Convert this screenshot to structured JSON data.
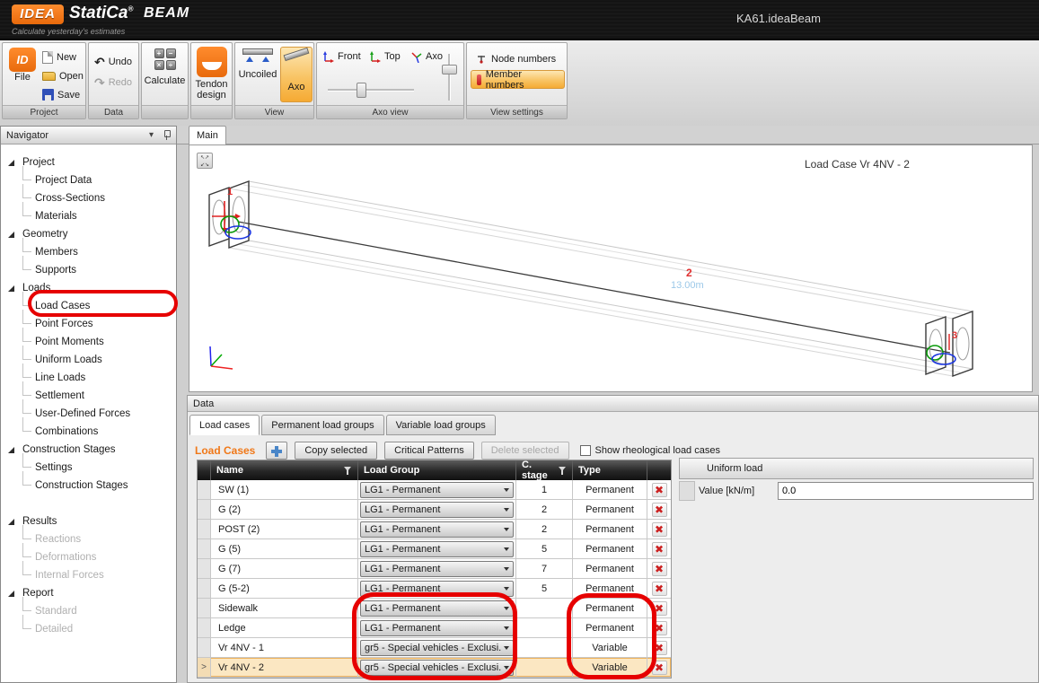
{
  "colors": {
    "accent_orange": "#f07818",
    "brand_orange": "#e86a0c",
    "selected_row_bg": "#fbe7c2",
    "annotation_red": "#e60000",
    "table_header_bg": "#262626",
    "delete_red": "#cc2020",
    "plus_blue": "#4a86c8"
  },
  "title_bar": {
    "logo_idea": "IDEA",
    "logo_statica": "StatiCa",
    "logo_reg": "®",
    "logo_beam": "BEAM",
    "tagline": "Calculate yesterday's estimates",
    "document_title": "KA61.ideaBeam"
  },
  "ribbon": {
    "project": {
      "group_label": "Project",
      "file": "File",
      "file_icon_text": "ID",
      "new": "New",
      "open": "Open",
      "save": "Save"
    },
    "data_group": {
      "group_label": "Data",
      "undo": "Undo",
      "redo": "Redo",
      "undo_icon": "↶",
      "redo_icon": "↷"
    },
    "calculate": {
      "label": "Calculate",
      "glyph_plus": "+",
      "glyph_minus": "−",
      "glyph_mult": "×",
      "glyph_div": "÷"
    },
    "tendon": {
      "label": "Tendon design"
    },
    "view": {
      "group_label": "View",
      "uncoiled": "Uncoiled",
      "axo": "Axo"
    },
    "axo_view": {
      "group_label": "Axo view",
      "front": "Front",
      "top": "Top",
      "axo": "Axo"
    },
    "view_settings": {
      "group_label": "View settings",
      "node_numbers": "Node numbers",
      "member_numbers": "Member numbers"
    }
  },
  "navigator": {
    "title": "Navigator",
    "collapse_icon": "▾",
    "tree": [
      {
        "label": "Project",
        "level": 0
      },
      {
        "label": "Project Data",
        "level": 1
      },
      {
        "label": "Cross-Sections",
        "level": 1
      },
      {
        "label": "Materials",
        "level": 1
      },
      {
        "label": "Geometry",
        "level": 0
      },
      {
        "label": "Members",
        "level": 1
      },
      {
        "label": "Supports",
        "level": 1
      },
      {
        "label": "Loads",
        "level": 0
      },
      {
        "label": "Load Cases",
        "level": 1,
        "circled": true
      },
      {
        "label": "Point Forces",
        "level": 1
      },
      {
        "label": "Point Moments",
        "level": 1
      },
      {
        "label": "Uniform Loads",
        "level": 1
      },
      {
        "label": "Line Loads",
        "level": 1
      },
      {
        "label": "Settlement",
        "level": 1
      },
      {
        "label": "User-Defined Forces",
        "level": 1
      },
      {
        "label": "Combinations",
        "level": 1
      },
      {
        "label": "Construction Stages",
        "level": 0
      },
      {
        "label": "Settings",
        "level": 1
      },
      {
        "label": "Construction Stages",
        "level": 1
      },
      {
        "label": "Results",
        "level": 0,
        "gap": true
      },
      {
        "label": "Reactions",
        "level": 1,
        "disabled": true
      },
      {
        "label": "Deformations",
        "level": 1,
        "disabled": true
      },
      {
        "label": "Internal Forces",
        "level": 1,
        "disabled": true
      },
      {
        "label": "Report",
        "level": 0
      },
      {
        "label": "Standard",
        "level": 1,
        "disabled": true
      },
      {
        "label": "Detailed",
        "level": 1,
        "disabled": true
      }
    ]
  },
  "main_tab": {
    "label": "Main"
  },
  "viewport": {
    "title": "Load Case Vr 4NV - 2",
    "member_number": "2",
    "member_length": "13.00m",
    "start_member_number": "1",
    "end_member_number": "3",
    "expand_icon_top": "↖↗",
    "expand_icon_bottom": "↙↘"
  },
  "data_panel": {
    "title": "Data",
    "tabs": [
      {
        "label": "Load cases",
        "active": true
      },
      {
        "label": "Permanent load groups",
        "active": false
      },
      {
        "label": "Variable load groups",
        "active": false
      }
    ],
    "toolbar": {
      "heading": "Load Cases",
      "copy": "Copy selected",
      "critical": "Critical Patterns",
      "delete": "Delete selected",
      "show_rheological": "Show rheological load cases",
      "checkbox_checked": false
    },
    "table": {
      "columns": [
        "Name",
        "Load Group",
        "C. stage",
        "Type"
      ],
      "rows": [
        {
          "name": "SW (1)",
          "group": "LG1 - Permanent",
          "stage": "1",
          "type": "Permanent",
          "selected": false
        },
        {
          "name": "G (2)",
          "group": "LG1 - Permanent",
          "stage": "2",
          "type": "Permanent",
          "selected": false
        },
        {
          "name": "POST (2)",
          "group": "LG1 - Permanent",
          "stage": "2",
          "type": "Permanent",
          "selected": false
        },
        {
          "name": "G (5)",
          "group": "LG1 - Permanent",
          "stage": "5",
          "type": "Permanent",
          "selected": false
        },
        {
          "name": "G (7)",
          "group": "LG1 - Permanent",
          "stage": "7",
          "type": "Permanent",
          "selected": false
        },
        {
          "name": "G (5-2)",
          "group": "LG1 - Permanent",
          "stage": "5",
          "type": "Permanent",
          "selected": false
        },
        {
          "name": "Sidewalk",
          "group": "LG1 - Permanent",
          "stage": "",
          "type": "Permanent",
          "selected": false
        },
        {
          "name": "Ledge",
          "group": "LG1 - Permanent",
          "stage": "",
          "type": "Permanent",
          "selected": false
        },
        {
          "name": "Vr 4NV - 1",
          "group": "gr5 - Special vehicles - Exclusi...",
          "stage": "",
          "type": "Variable",
          "selected": false
        },
        {
          "name": "Vr 4NV - 2",
          "group": "gr5 - Special vehicles - Exclusi...",
          "stage": "",
          "type": "Variable",
          "selected": true
        }
      ]
    },
    "properties": {
      "header": "Uniform load",
      "value_label": "Value [kN/m]",
      "value": "0.0"
    }
  }
}
